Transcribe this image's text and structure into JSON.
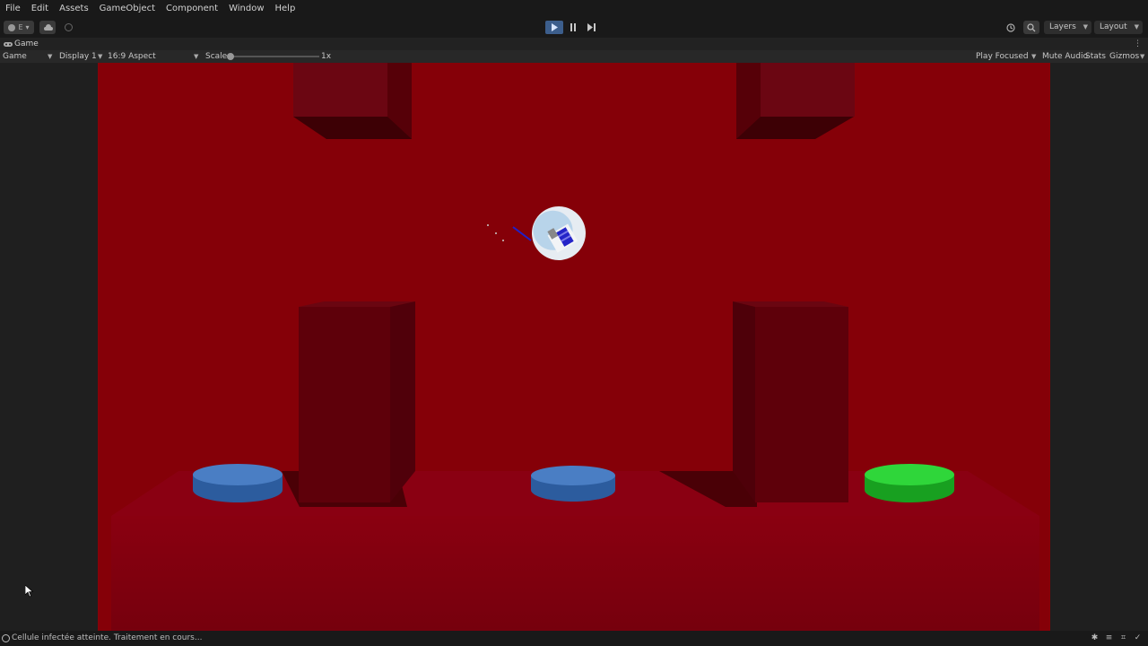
{
  "menubar": {
    "items": [
      "File",
      "Edit",
      "Assets",
      "GameObject",
      "Component",
      "Window",
      "Help"
    ]
  },
  "toolbar": {
    "account_label": "E",
    "layers_label": "Layers",
    "layout_label": "Layout",
    "play_state": "playing"
  },
  "tab": {
    "label": "Game"
  },
  "gamebar": {
    "view_mode": "Game",
    "display": "Display 1",
    "aspect": "16:9 Aspect",
    "scale_label": "Scale",
    "scale_value": "1x",
    "play_mode": "Play Focused",
    "mute_audio": "Mute Audio",
    "stats": "Stats",
    "gizmos": "Gizmos"
  },
  "status": {
    "message": "Cellule infectée atteinte. Traitement en cours..."
  },
  "colors": {
    "scene_background": "#850008",
    "platform_blue": "#3b6fb5",
    "platform_green": "#22c22a",
    "accent_play": "#3c5e8c"
  }
}
